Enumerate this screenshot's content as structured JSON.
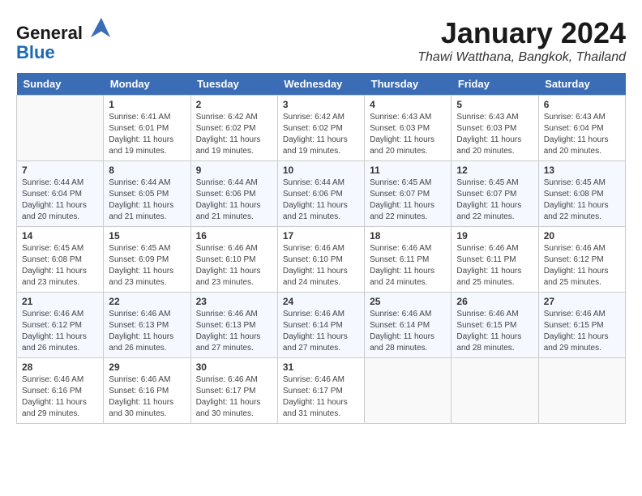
{
  "header": {
    "logo_line1": "General",
    "logo_line2": "Blue",
    "month": "January 2024",
    "location": "Thawi Watthana, Bangkok, Thailand"
  },
  "weekdays": [
    "Sunday",
    "Monday",
    "Tuesday",
    "Wednesday",
    "Thursday",
    "Friday",
    "Saturday"
  ],
  "weeks": [
    [
      {
        "day": "",
        "info": ""
      },
      {
        "day": "1",
        "info": "Sunrise: 6:41 AM\nSunset: 6:01 PM\nDaylight: 11 hours\nand 19 minutes."
      },
      {
        "day": "2",
        "info": "Sunrise: 6:42 AM\nSunset: 6:02 PM\nDaylight: 11 hours\nand 19 minutes."
      },
      {
        "day": "3",
        "info": "Sunrise: 6:42 AM\nSunset: 6:02 PM\nDaylight: 11 hours\nand 19 minutes."
      },
      {
        "day": "4",
        "info": "Sunrise: 6:43 AM\nSunset: 6:03 PM\nDaylight: 11 hours\nand 20 minutes."
      },
      {
        "day": "5",
        "info": "Sunrise: 6:43 AM\nSunset: 6:03 PM\nDaylight: 11 hours\nand 20 minutes."
      },
      {
        "day": "6",
        "info": "Sunrise: 6:43 AM\nSunset: 6:04 PM\nDaylight: 11 hours\nand 20 minutes."
      }
    ],
    [
      {
        "day": "7",
        "info": "Sunrise: 6:44 AM\nSunset: 6:04 PM\nDaylight: 11 hours\nand 20 minutes."
      },
      {
        "day": "8",
        "info": "Sunrise: 6:44 AM\nSunset: 6:05 PM\nDaylight: 11 hours\nand 21 minutes."
      },
      {
        "day": "9",
        "info": "Sunrise: 6:44 AM\nSunset: 6:06 PM\nDaylight: 11 hours\nand 21 minutes."
      },
      {
        "day": "10",
        "info": "Sunrise: 6:44 AM\nSunset: 6:06 PM\nDaylight: 11 hours\nand 21 minutes."
      },
      {
        "day": "11",
        "info": "Sunrise: 6:45 AM\nSunset: 6:07 PM\nDaylight: 11 hours\nand 22 minutes."
      },
      {
        "day": "12",
        "info": "Sunrise: 6:45 AM\nSunset: 6:07 PM\nDaylight: 11 hours\nand 22 minutes."
      },
      {
        "day": "13",
        "info": "Sunrise: 6:45 AM\nSunset: 6:08 PM\nDaylight: 11 hours\nand 22 minutes."
      }
    ],
    [
      {
        "day": "14",
        "info": "Sunrise: 6:45 AM\nSunset: 6:08 PM\nDaylight: 11 hours\nand 23 minutes."
      },
      {
        "day": "15",
        "info": "Sunrise: 6:45 AM\nSunset: 6:09 PM\nDaylight: 11 hours\nand 23 minutes."
      },
      {
        "day": "16",
        "info": "Sunrise: 6:46 AM\nSunset: 6:10 PM\nDaylight: 11 hours\nand 23 minutes."
      },
      {
        "day": "17",
        "info": "Sunrise: 6:46 AM\nSunset: 6:10 PM\nDaylight: 11 hours\nand 24 minutes."
      },
      {
        "day": "18",
        "info": "Sunrise: 6:46 AM\nSunset: 6:11 PM\nDaylight: 11 hours\nand 24 minutes."
      },
      {
        "day": "19",
        "info": "Sunrise: 6:46 AM\nSunset: 6:11 PM\nDaylight: 11 hours\nand 25 minutes."
      },
      {
        "day": "20",
        "info": "Sunrise: 6:46 AM\nSunset: 6:12 PM\nDaylight: 11 hours\nand 25 minutes."
      }
    ],
    [
      {
        "day": "21",
        "info": "Sunrise: 6:46 AM\nSunset: 6:12 PM\nDaylight: 11 hours\nand 26 minutes."
      },
      {
        "day": "22",
        "info": "Sunrise: 6:46 AM\nSunset: 6:13 PM\nDaylight: 11 hours\nand 26 minutes."
      },
      {
        "day": "23",
        "info": "Sunrise: 6:46 AM\nSunset: 6:13 PM\nDaylight: 11 hours\nand 27 minutes."
      },
      {
        "day": "24",
        "info": "Sunrise: 6:46 AM\nSunset: 6:14 PM\nDaylight: 11 hours\nand 27 minutes."
      },
      {
        "day": "25",
        "info": "Sunrise: 6:46 AM\nSunset: 6:14 PM\nDaylight: 11 hours\nand 28 minutes."
      },
      {
        "day": "26",
        "info": "Sunrise: 6:46 AM\nSunset: 6:15 PM\nDaylight: 11 hours\nand 28 minutes."
      },
      {
        "day": "27",
        "info": "Sunrise: 6:46 AM\nSunset: 6:15 PM\nDaylight: 11 hours\nand 29 minutes."
      }
    ],
    [
      {
        "day": "28",
        "info": "Sunrise: 6:46 AM\nSunset: 6:16 PM\nDaylight: 11 hours\nand 29 minutes."
      },
      {
        "day": "29",
        "info": "Sunrise: 6:46 AM\nSunset: 6:16 PM\nDaylight: 11 hours\nand 30 minutes."
      },
      {
        "day": "30",
        "info": "Sunrise: 6:46 AM\nSunset: 6:17 PM\nDaylight: 11 hours\nand 30 minutes."
      },
      {
        "day": "31",
        "info": "Sunrise: 6:46 AM\nSunset: 6:17 PM\nDaylight: 11 hours\nand 31 minutes."
      },
      {
        "day": "",
        "info": ""
      },
      {
        "day": "",
        "info": ""
      },
      {
        "day": "",
        "info": ""
      }
    ]
  ]
}
